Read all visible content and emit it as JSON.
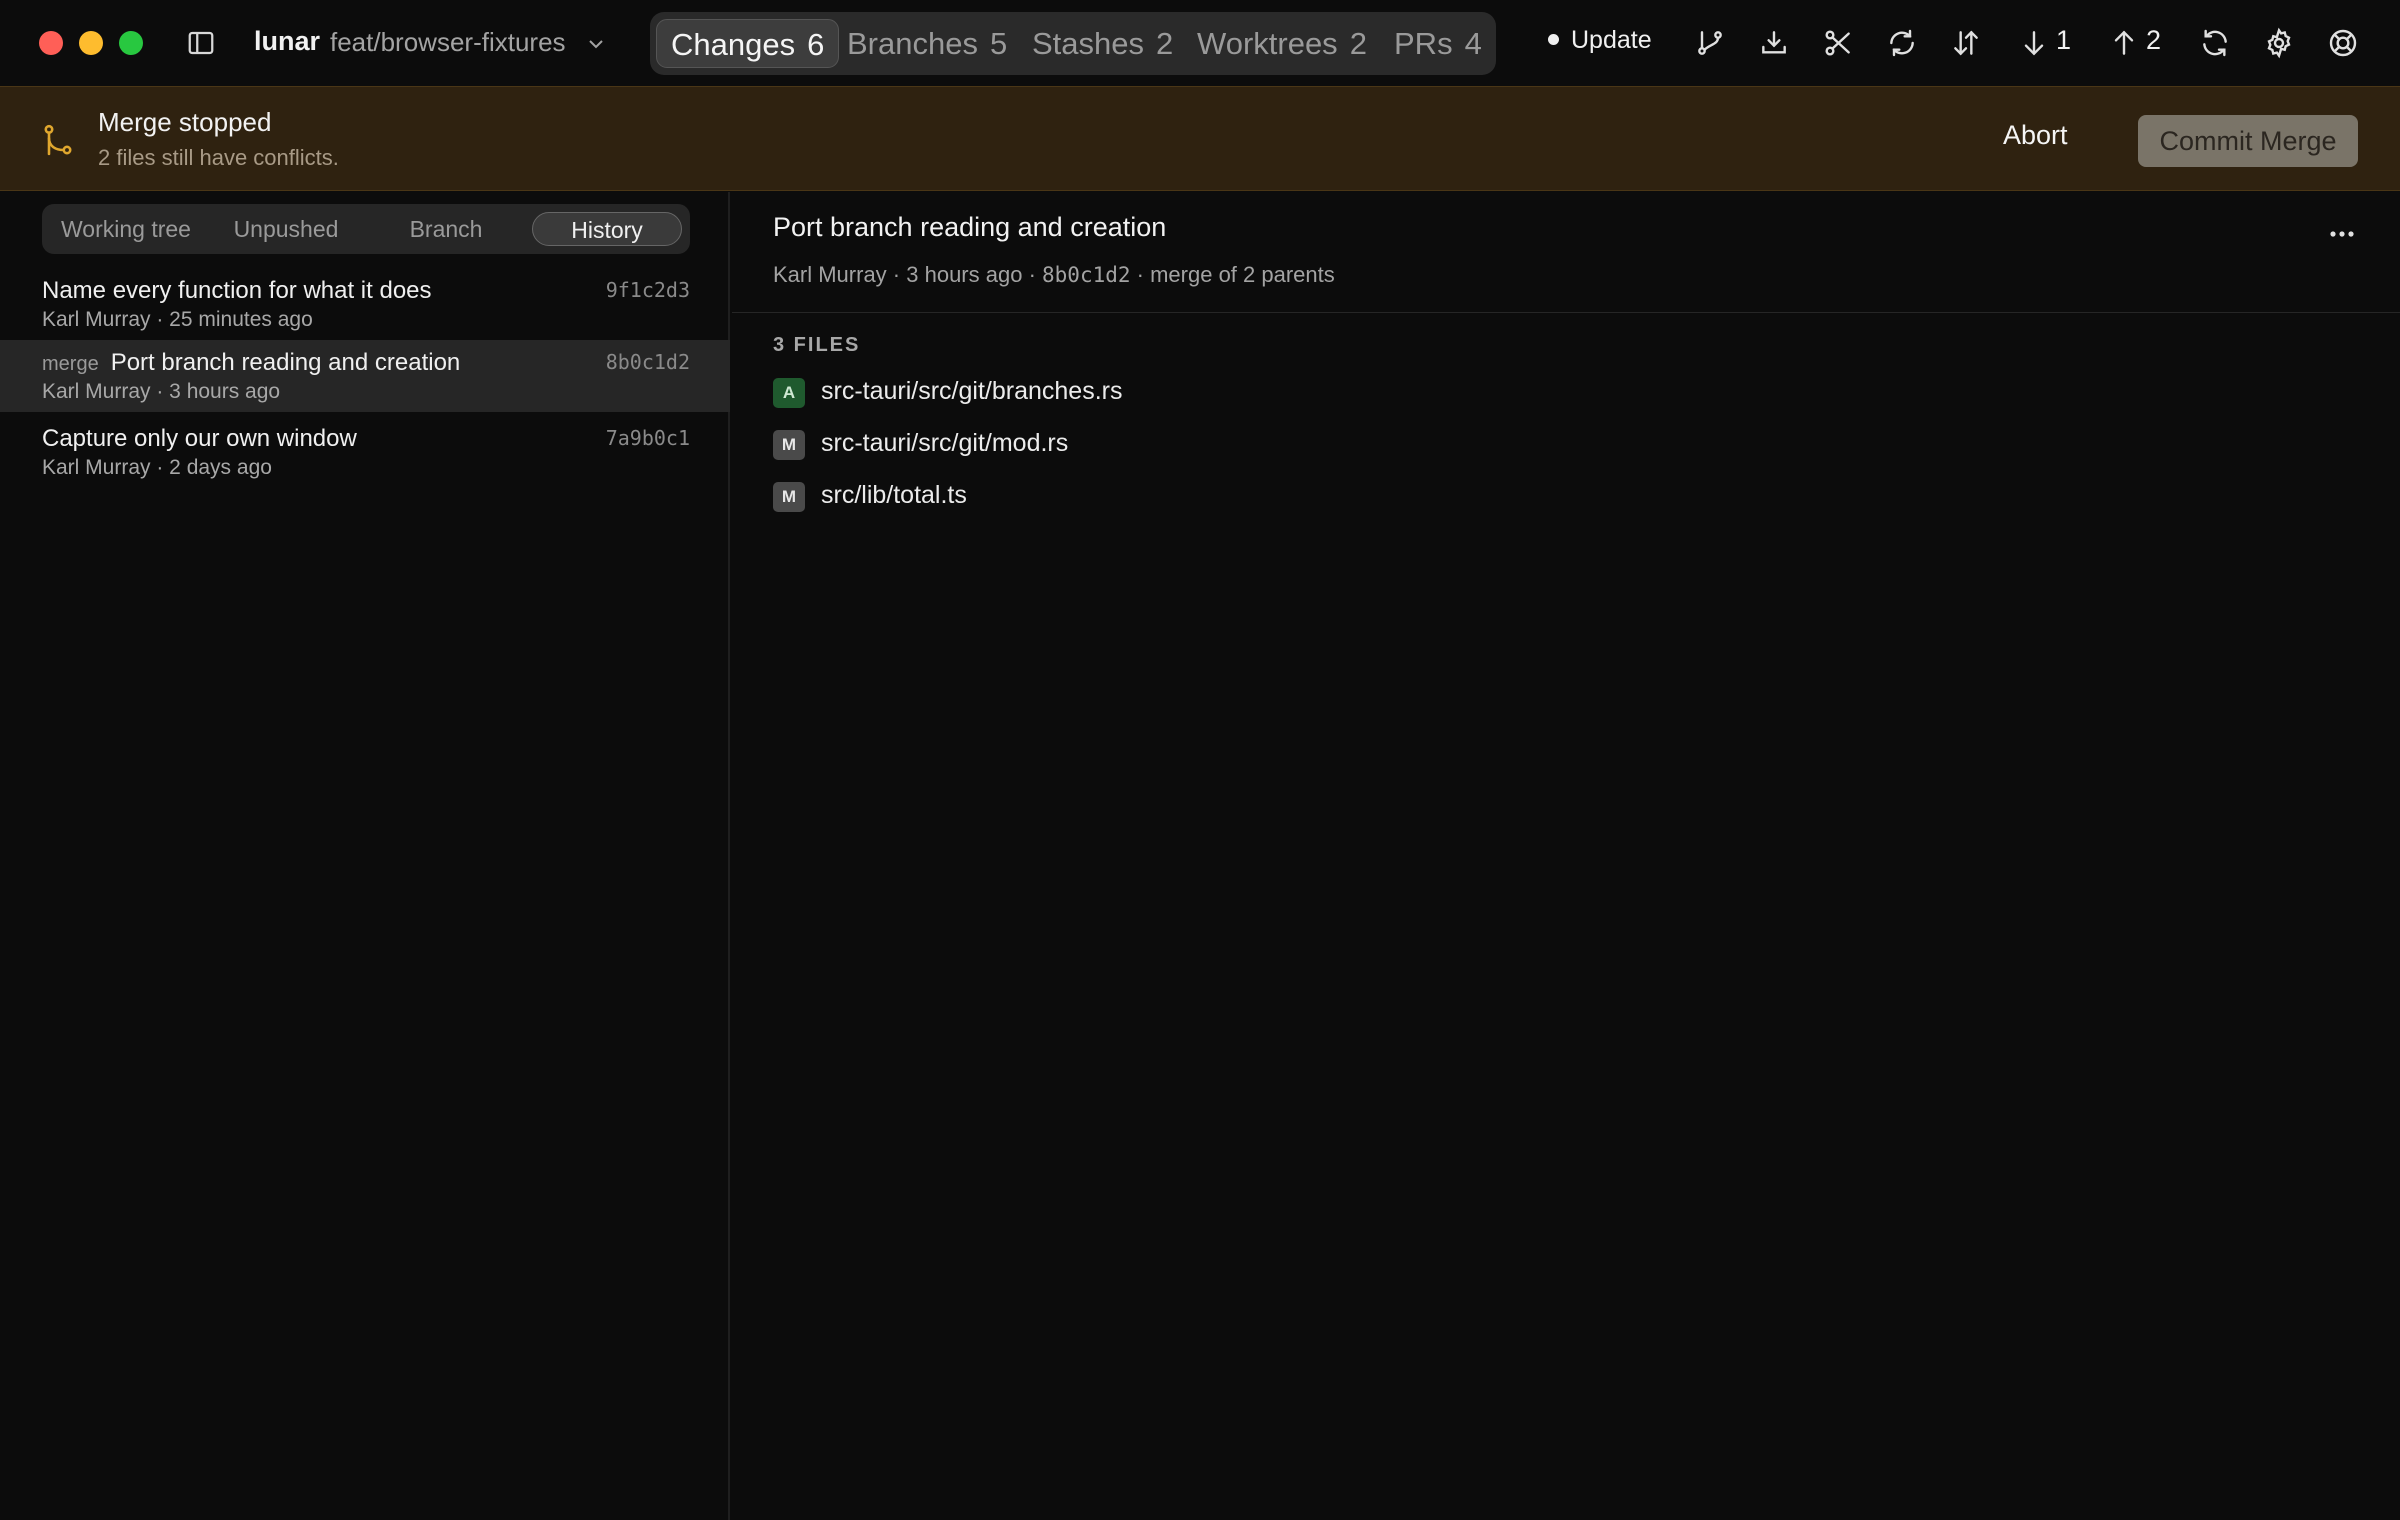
{
  "titlebar": {
    "repo": "lunar",
    "branch": "feat/browser-fixtures",
    "tabs": [
      {
        "label": "Changes",
        "count": "6"
      },
      {
        "label": "Branches",
        "count": "5"
      },
      {
        "label": "Stashes",
        "count": "2"
      },
      {
        "label": "Worktrees",
        "count": "2"
      },
      {
        "label": "PRs",
        "count": "4"
      }
    ],
    "update_label": "Update",
    "pull_count": "1",
    "push_count": "2",
    "icons": [
      "sidebar-icon",
      "chevron-down-icon",
      "branch-icon",
      "download-icon",
      "scissors-icon",
      "sync-icon",
      "swap-icon",
      "arrow-down-icon",
      "arrow-up-icon",
      "refresh-icon",
      "gear-icon",
      "help-icon"
    ]
  },
  "banner": {
    "title": "Merge stopped",
    "subtitle": "2 files still have conflicts.",
    "abort_label": "Abort",
    "commit_label": "Commit Merge"
  },
  "left": {
    "segments": [
      "Working tree",
      "Unpushed",
      "Branch",
      "History"
    ],
    "active_segment": "History",
    "commits": [
      {
        "tag": "",
        "title": "Name every function for what it does",
        "meta": "Karl Murray · 25 minutes ago",
        "hash": "9f1c2d3"
      },
      {
        "tag": "merge",
        "title": "Port branch reading and creation",
        "meta": "Karl Murray · 3 hours ago",
        "hash": "8b0c1d2"
      },
      {
        "tag": "",
        "title": "Capture only our own window",
        "meta": "Karl Murray · 2 days ago",
        "hash": "7a9b0c1"
      }
    ]
  },
  "detail": {
    "title": "Port branch reading and creation",
    "author": "Karl Murray",
    "time": "3 hours ago",
    "hash": "8b0c1d2",
    "parents": "merge of 2 parents",
    "files_header": "3 FILES",
    "files": [
      {
        "status": "A",
        "path": "src-tauri/src/git/branches.rs"
      },
      {
        "status": "M",
        "path": "src-tauri/src/git/mod.rs"
      },
      {
        "status": "M",
        "path": "src/lib/total.ts"
      }
    ]
  },
  "colors": {
    "background": "#0c0c0c",
    "banner": "#2f2210",
    "banner_icon": "#e0a72e",
    "added_badge": "#1f5a2e",
    "modified_badge": "#4a4a4a",
    "commit_button": "#7a7468"
  }
}
